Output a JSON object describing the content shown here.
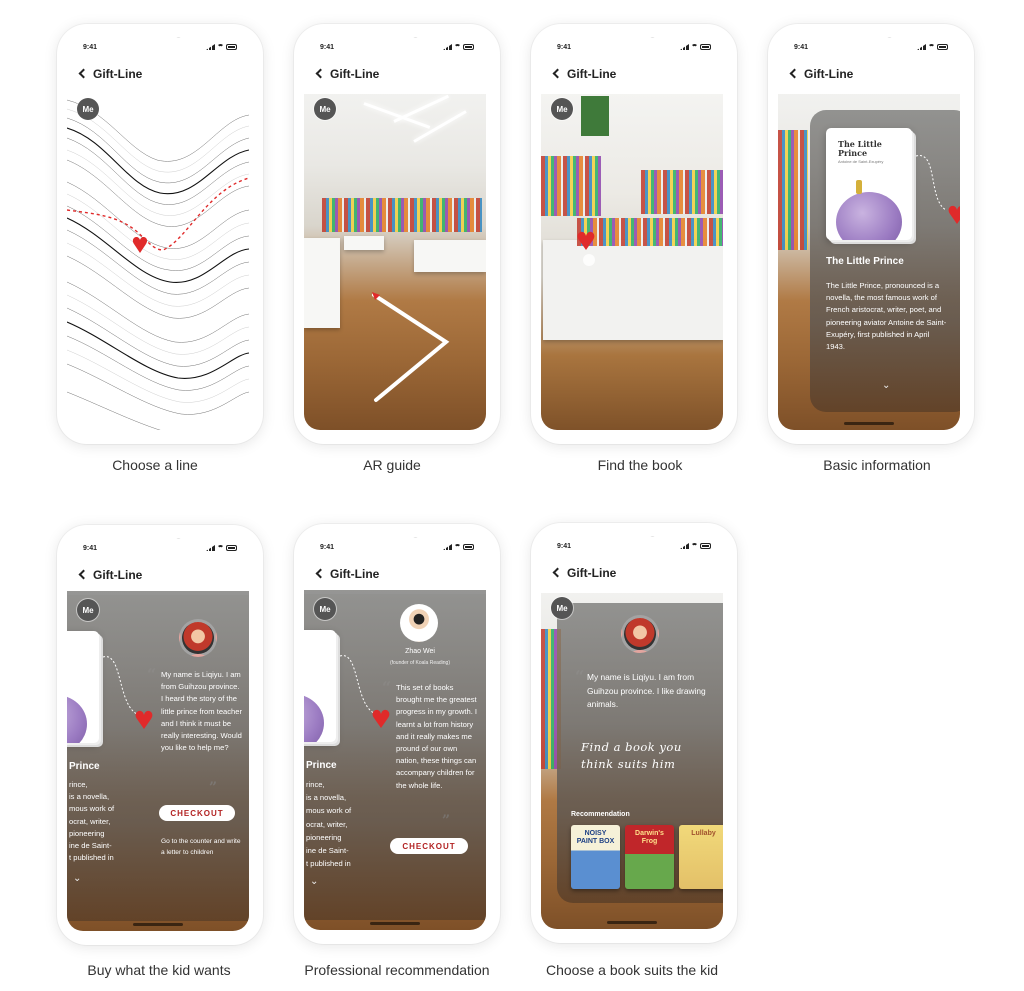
{
  "app": {
    "title": "Gift-Line",
    "time": "9:41",
    "me_label": "Me"
  },
  "screens": [
    {
      "caption": "Choose a line"
    },
    {
      "caption": "AR guide"
    },
    {
      "caption": "Find the book"
    },
    {
      "caption": "Basic information",
      "book": {
        "cover_title": "The Little Prince",
        "cover_subtitle": "Antoine de Saint-Exupéry",
        "title": "The Little Prince",
        "description": "The Little Prince, pronounced is a novella, the most famous work of French aristocrat, writer, poet, and pioneering aviator Antoine de Saint-Exupéry, first published in April 1943."
      }
    },
    {
      "caption": "Buy what the kid wants",
      "partial_title": "Prince",
      "partial_text": [
        "rince,",
        "is a novella,",
        "mous work of",
        "ocrat, writer,",
        "pioneering",
        "ine de Saint-",
        "t published in"
      ],
      "message": "My name is Liqiyu. I am from Guihzou province. I heard the story of the little prince from teacher and I think it must be really interesting. Would you like to help me?",
      "checkout_label": "CHECKOUT",
      "hint": "Go to the counter and write a letter to children"
    },
    {
      "caption": "Professional recommendation",
      "partial_title": "Prince",
      "partial_text": [
        "rince,",
        "is a novella,",
        "mous work of",
        "ocrat, writer,",
        "pioneering",
        "ine de Saint-",
        "t published in"
      ],
      "expert_name": "Zhao Wei",
      "expert_role": "(founder of Koala Reading)",
      "message": "This set of books brought me the greatest progress in my growth. I learnt a lot from history and it really makes me pround of our own nation, these things can accompany children for the whole life.",
      "checkout_label": "CHECKOUT"
    },
    {
      "caption": "Choose a book suits the kid",
      "message": "My name is Liqiyu. I am from Guihzou province. I like drawing animals.",
      "prompt": "Find a book you think suits him",
      "rec_label": "Recommendation",
      "books": [
        "NOISY PAINT BOX",
        "Darwin's Frog",
        "Lullaby"
      ]
    }
  ],
  "colors": {
    "accent": "#e02a2a",
    "text": "#222222",
    "panel": "#6f6b66"
  }
}
